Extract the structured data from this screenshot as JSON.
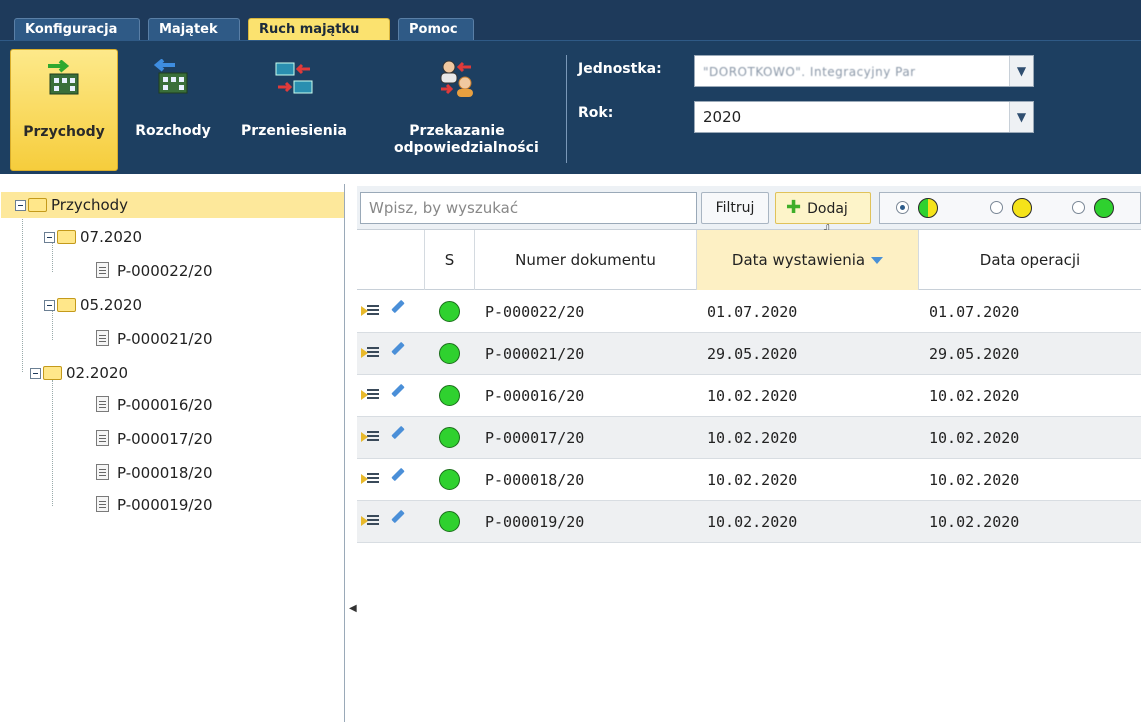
{
  "tabs": [
    {
      "label": "Konfiguracja",
      "active": false
    },
    {
      "label": "Majątek",
      "active": false
    },
    {
      "label": "Ruch majątku",
      "active": true
    },
    {
      "label": "Pomoc",
      "active": false
    }
  ],
  "ribbon": {
    "buttons": [
      {
        "label": "Przychody",
        "icon": "income-building-icon",
        "active": true
      },
      {
        "label": "Rozchody",
        "icon": "expense-building-icon",
        "active": false
      },
      {
        "label": "Przeniesienia",
        "icon": "transfer-icon",
        "active": false
      },
      {
        "label": "Przekazanie odpowiedzialności",
        "icon": "handover-persons-icon",
        "active": false
      }
    ],
    "unit_label": "Jednostka:",
    "unit_value": "\"DOROTKOWO\". Integracyjny Par",
    "year_label": "Rok:",
    "year_value": "2020"
  },
  "tree": {
    "root": "Przychody",
    "groups": [
      {
        "label": "07.2020",
        "items": [
          "P-000022/20"
        ]
      },
      {
        "label": "05.2020",
        "items": [
          "P-000021/20"
        ]
      },
      {
        "label": "02.2020",
        "items": [
          "P-000016/20",
          "P-000017/20",
          "P-000018/20",
          "P-000019/20"
        ]
      }
    ]
  },
  "toolbar": {
    "search_placeholder": "Wpisz, by wyszukać",
    "filter_label": "Filtruj",
    "add_label": "Dodaj",
    "status_filters": [
      {
        "colors": [
          "#2fd12f",
          "#f5e31a"
        ],
        "selected": true
      },
      {
        "colors": [
          "#f5e31a"
        ],
        "selected": false
      },
      {
        "colors": [
          "#2fd12f"
        ],
        "selected": false
      }
    ]
  },
  "grid": {
    "headers": {
      "s": "S",
      "number": "Numer dokumentu",
      "issue_date": "Data wystawienia",
      "op_date": "Data operacji"
    },
    "rows": [
      {
        "number": "P-000022/20",
        "issue_date": "01.07.2020",
        "op_date": "01.07.2020"
      },
      {
        "number": "P-000021/20",
        "issue_date": "29.05.2020",
        "op_date": "29.05.2020"
      },
      {
        "number": "P-000016/20",
        "issue_date": "10.02.2020",
        "op_date": "10.02.2020"
      },
      {
        "number": "P-000017/20",
        "issue_date": "10.02.2020",
        "op_date": "10.02.2020"
      },
      {
        "number": "P-000018/20",
        "issue_date": "10.02.2020",
        "op_date": "10.02.2020"
      },
      {
        "number": "P-000019/20",
        "issue_date": "10.02.2020",
        "op_date": "10.02.2020"
      }
    ],
    "status_color": "#2fd12f"
  }
}
